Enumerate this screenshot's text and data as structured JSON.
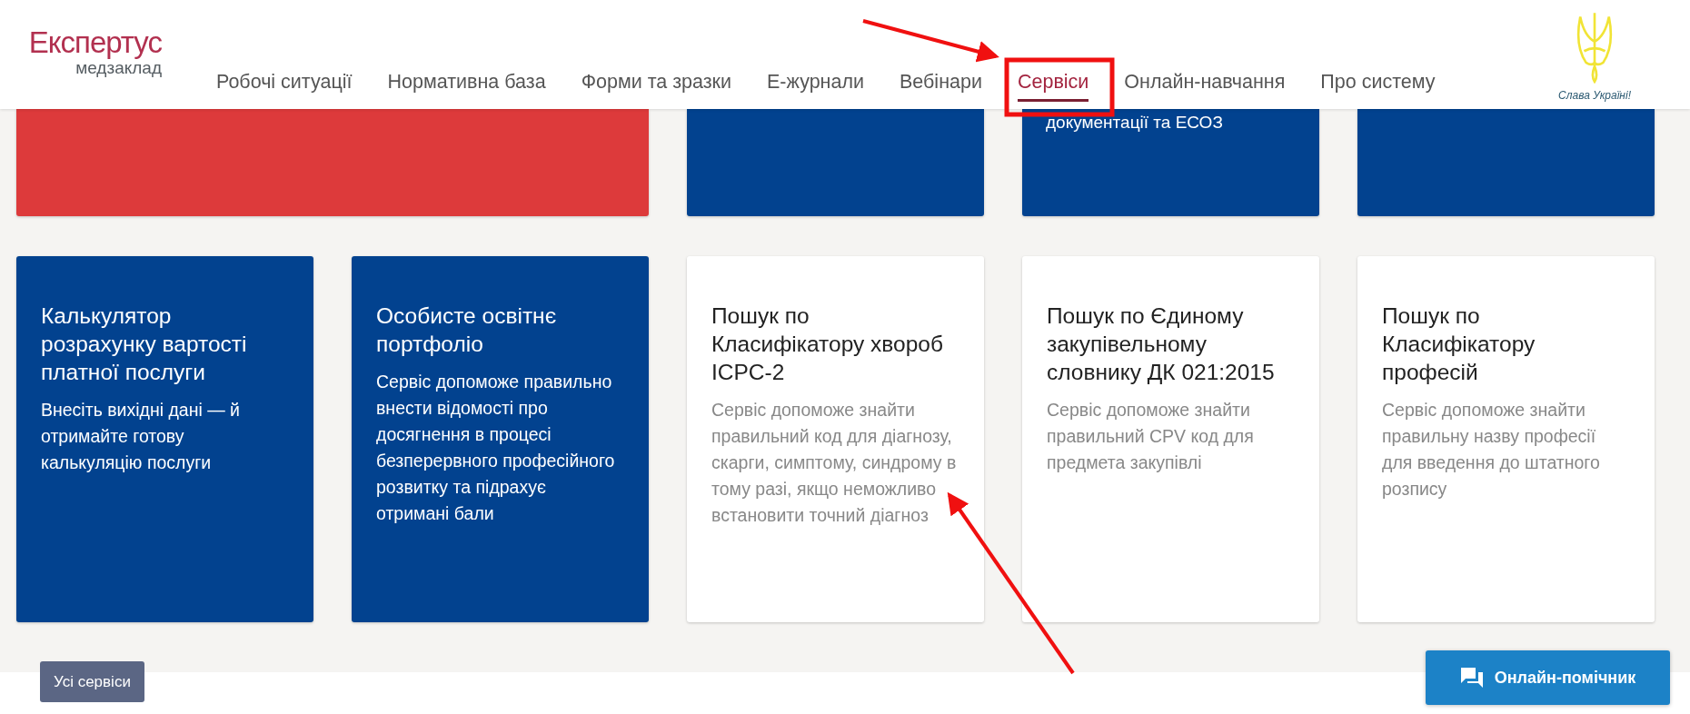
{
  "logo": {
    "name": "Експертус",
    "subtitle": "медзаклад"
  },
  "nav": [
    {
      "label": "Робочі ситуації",
      "selected": false
    },
    {
      "label": "Нормативна база",
      "selected": false
    },
    {
      "label": "Форми та зразки",
      "selected": false
    },
    {
      "label": "Е-журнали",
      "selected": false
    },
    {
      "label": "Вебінари",
      "selected": false
    },
    {
      "label": "Сервіси",
      "selected": true
    },
    {
      "label": "Онлайн-навчання",
      "selected": false
    },
    {
      "label": "Про систему",
      "selected": false
    }
  ],
  "emblem": {
    "caption": "Слава Україні!"
  },
  "top_cards": [
    {
      "color": "#dd3a3b",
      "wide": true
    },
    {
      "color": "#02428f",
      "wide": false
    },
    {
      "color": "#02428f",
      "wide": false,
      "text": "документації та ЕСОЗ"
    },
    {
      "color": "#02428f",
      "wide": false
    }
  ],
  "cards": [
    {
      "kind": "blue",
      "title": "Калькулятор розрахунку вартості платної послуги",
      "description": "Внесіть вихідні дані — й отримайте готову калькуляцію послуги"
    },
    {
      "kind": "blue",
      "title": "Особисте освітнє портфоліо",
      "description": "Сервіс допоможе правильно внести відомості про досягнення в процесі безперервного професійного розвитку та підрахує отримані бали"
    },
    {
      "kind": "white",
      "title": "Пошук по Класифікатору хвороб ICPC-2",
      "description": "Сервіс допоможе знайти правильний код для діагнозу, скарги, симптому, синдрому в тому разі, якщо неможливо встановити точний діагноз"
    },
    {
      "kind": "white",
      "title": "Пошук по Єдиному закупівельному словнику ДК 021:2015",
      "description": "Сервіс допоможе знайти правильний CPV код для предмета закупівлі"
    },
    {
      "kind": "white",
      "title": "Пошук по Класифікатору професій",
      "description": "Сервіс допоможе знайти правильну назву професії для введення до штатного розпису"
    }
  ],
  "all_services_button": "Усі сервіси",
  "chat_button": "Онлайн-помічник"
}
